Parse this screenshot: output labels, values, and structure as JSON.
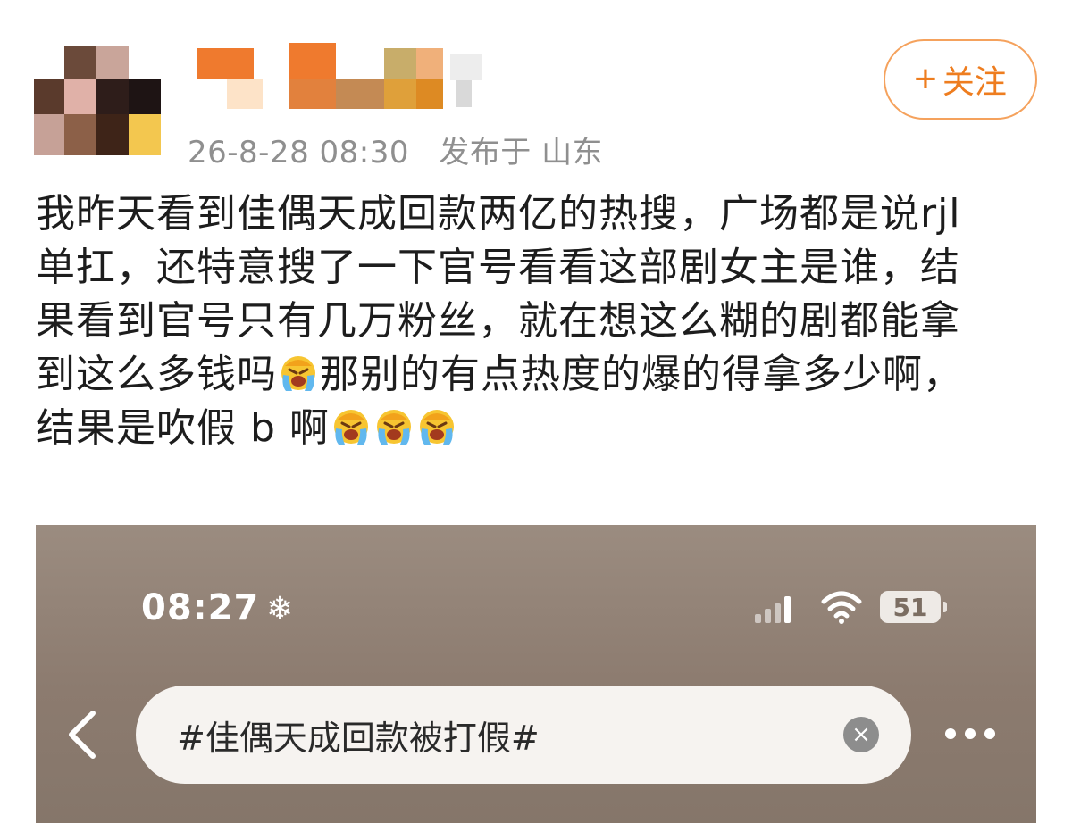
{
  "post": {
    "timestamp": "26-8-28 08:30",
    "location": "发布于 山东",
    "follow_label": "关注",
    "lines": [
      "我昨天看到佳偶天成回款两亿的热搜，广场都是说rjl",
      "单扛，还特意搜了一下官号看看这部剧女主是谁，结",
      "果看到官号只有几万粉丝，就在想这么糊的剧都能拿",
      {
        "before": "到这么多钱吗",
        "after": "那别的有点热度的爆的得拿多少啊，"
      },
      {
        "before": "结果是吹假 b 啊",
        "after": ""
      }
    ],
    "emoji_name": "crying-face-emoji"
  },
  "screenshot": {
    "clock": "08:27",
    "battery": "51",
    "search_query": "#佳偶天成回款被打假#",
    "clear_symbol": "×"
  },
  "colors": {
    "follow_accent": "#ee7d1f",
    "follow_border": "#f5a25d",
    "meta_gray": "#8f8f8f",
    "screenshot_bg": "#8c7b6f"
  }
}
